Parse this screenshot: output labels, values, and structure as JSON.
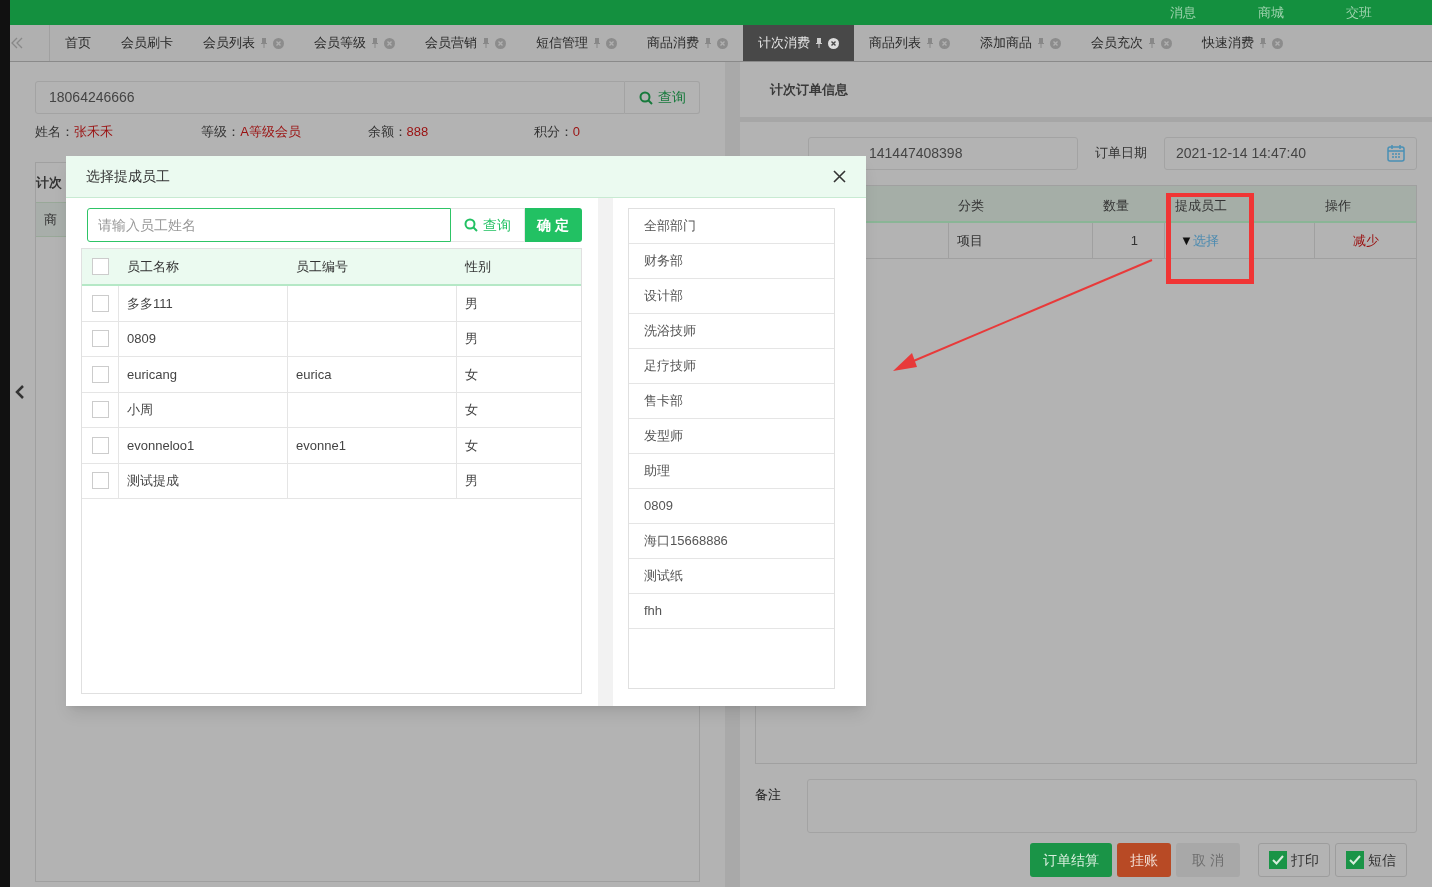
{
  "top_bar": {
    "links": [
      "消息",
      "商城",
      "交班"
    ]
  },
  "tabs": [
    {
      "label": "首页",
      "selected": false,
      "closable": false
    },
    {
      "label": "会员刷卡",
      "selected": false,
      "closable": false
    },
    {
      "label": "会员列表",
      "selected": false,
      "closable": true
    },
    {
      "label": "会员等级",
      "selected": false,
      "closable": true
    },
    {
      "label": "会员营销",
      "selected": false,
      "closable": true
    },
    {
      "label": "短信管理",
      "selected": false,
      "closable": true
    },
    {
      "label": "商品消费",
      "selected": false,
      "closable": true
    },
    {
      "label": "计次消费",
      "selected": true,
      "closable": true
    },
    {
      "label": "商品列表",
      "selected": false,
      "closable": true
    },
    {
      "label": "添加商品",
      "selected": false,
      "closable": true
    },
    {
      "label": "会员充次",
      "selected": false,
      "closable": true
    },
    {
      "label": "快速消费",
      "selected": false,
      "closable": true
    }
  ],
  "member": {
    "search_value": "18064246666",
    "search_button": "查询",
    "fields": [
      {
        "label": "姓名：",
        "value": "张禾禾"
      },
      {
        "label": "等级：",
        "value": "A等级会员"
      },
      {
        "label": "余额：",
        "value": "888"
      },
      {
        "label": "积分：",
        "value": "0"
      }
    ]
  },
  "left_panel": {
    "title": "计次",
    "column": "商"
  },
  "order": {
    "title": "计次订单信息",
    "number": "141447408398",
    "date_label": "订单日期",
    "date_value": "2021-12-14 14:47:40",
    "columns": [
      "分类",
      "数量",
      "提成员工",
      "操作"
    ],
    "rows": [
      {
        "category": "项目",
        "quantity": "1",
        "staff_caret": "▼",
        "staff_link": "选择",
        "action": "减少"
      }
    ],
    "note_label": "备注",
    "buttons": [
      {
        "label": "订单结算",
        "kind": "primary"
      },
      {
        "label": "挂账",
        "kind": "warning"
      },
      {
        "label": "取 消",
        "kind": "muted"
      }
    ],
    "toggles": [
      {
        "label": "打印",
        "checked": true
      },
      {
        "label": "短信",
        "checked": true
      }
    ]
  },
  "modal": {
    "title": "选择提成员工",
    "search_placeholder": "请输入员工姓名",
    "search_button": "查询",
    "confirm_button": "确 定",
    "columns": [
      "员工名称",
      "员工编号",
      "性别"
    ],
    "all_checked": false,
    "employees": [
      {
        "name": "多多111",
        "gender": "男",
        "checked": false
      },
      {
        "name": "0809",
        "gender": "男",
        "checked": false
      },
      {
        "name": "euricang",
        "code": "eurica",
        "gender": "女",
        "checked": false
      },
      {
        "name": "小周",
        "gender": "女",
        "checked": false
      },
      {
        "name": "evonneloo1",
        "code": "evonne1",
        "gender": "女",
        "checked": false
      },
      {
        "name": "测试提成",
        "gender": "男",
        "checked": false
      }
    ],
    "departments": [
      "全部部门",
      "财务部",
      "设计部",
      "洗浴技师",
      "足疗技师",
      "售卡部",
      "发型师",
      "助理",
      "0809",
      "海口15668886",
      "测试纸",
      "fhh"
    ]
  }
}
